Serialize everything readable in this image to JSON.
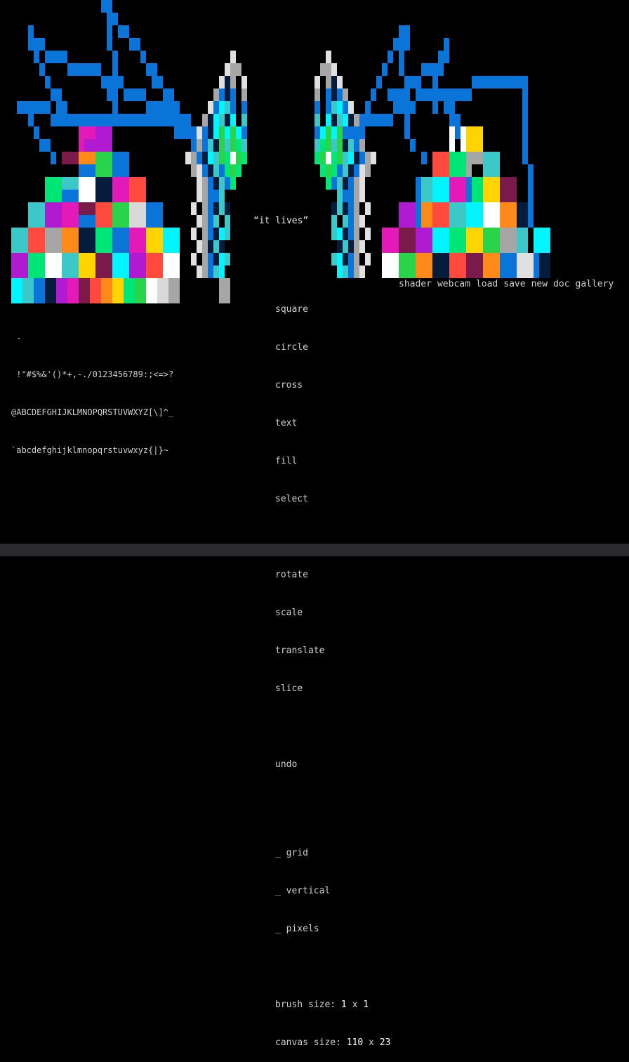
{
  "caption": "“it lives”",
  "palette": {
    "lines": [
      " .",
      " !\"#$%&'()*+,-./0123456789:;<=>?",
      "@ABCDEFGHIJKLMNOPQRSTUVWXYZ[\\]^_",
      "`abcdefghijklmnopqrstuvwxyz{|}~"
    ]
  },
  "tools": {
    "square": "square",
    "circle": "circle",
    "cross": "cross",
    "text": "text",
    "fill": "fill",
    "select": "select",
    "rotate": "rotate",
    "scale": "scale",
    "translate": "translate",
    "slice": "slice",
    "undo": "undo",
    "grid": "_ grid",
    "vertical": "_ vertical",
    "pixels": "_ pixels",
    "brush_label": "brush size: ",
    "brush_w": "1",
    "brush_x": " x ",
    "brush_h": "1",
    "canvas_label": "canvas size: ",
    "canvas_w": "110",
    "canvas_x": " x ",
    "canvas_h": "23"
  },
  "menu": {
    "shader": "shader",
    "webcam": "webcam",
    "load": "load",
    "save": "save",
    "new": "new",
    "doc": "doc",
    "gallery": "gallery"
  },
  "colors": {
    "background": "#000000",
    "blue": "#0a74d8",
    "cyan": "#00f5ff",
    "magenta": "#e41ab8",
    "green": "#2ad44a",
    "white": "#f2f2f2",
    "gray": "#a6a6a6",
    "yellow": "#ffd400",
    "orange": "#ff8a1a",
    "red": "#ff4a3d",
    "navy": "#061c3d"
  }
}
